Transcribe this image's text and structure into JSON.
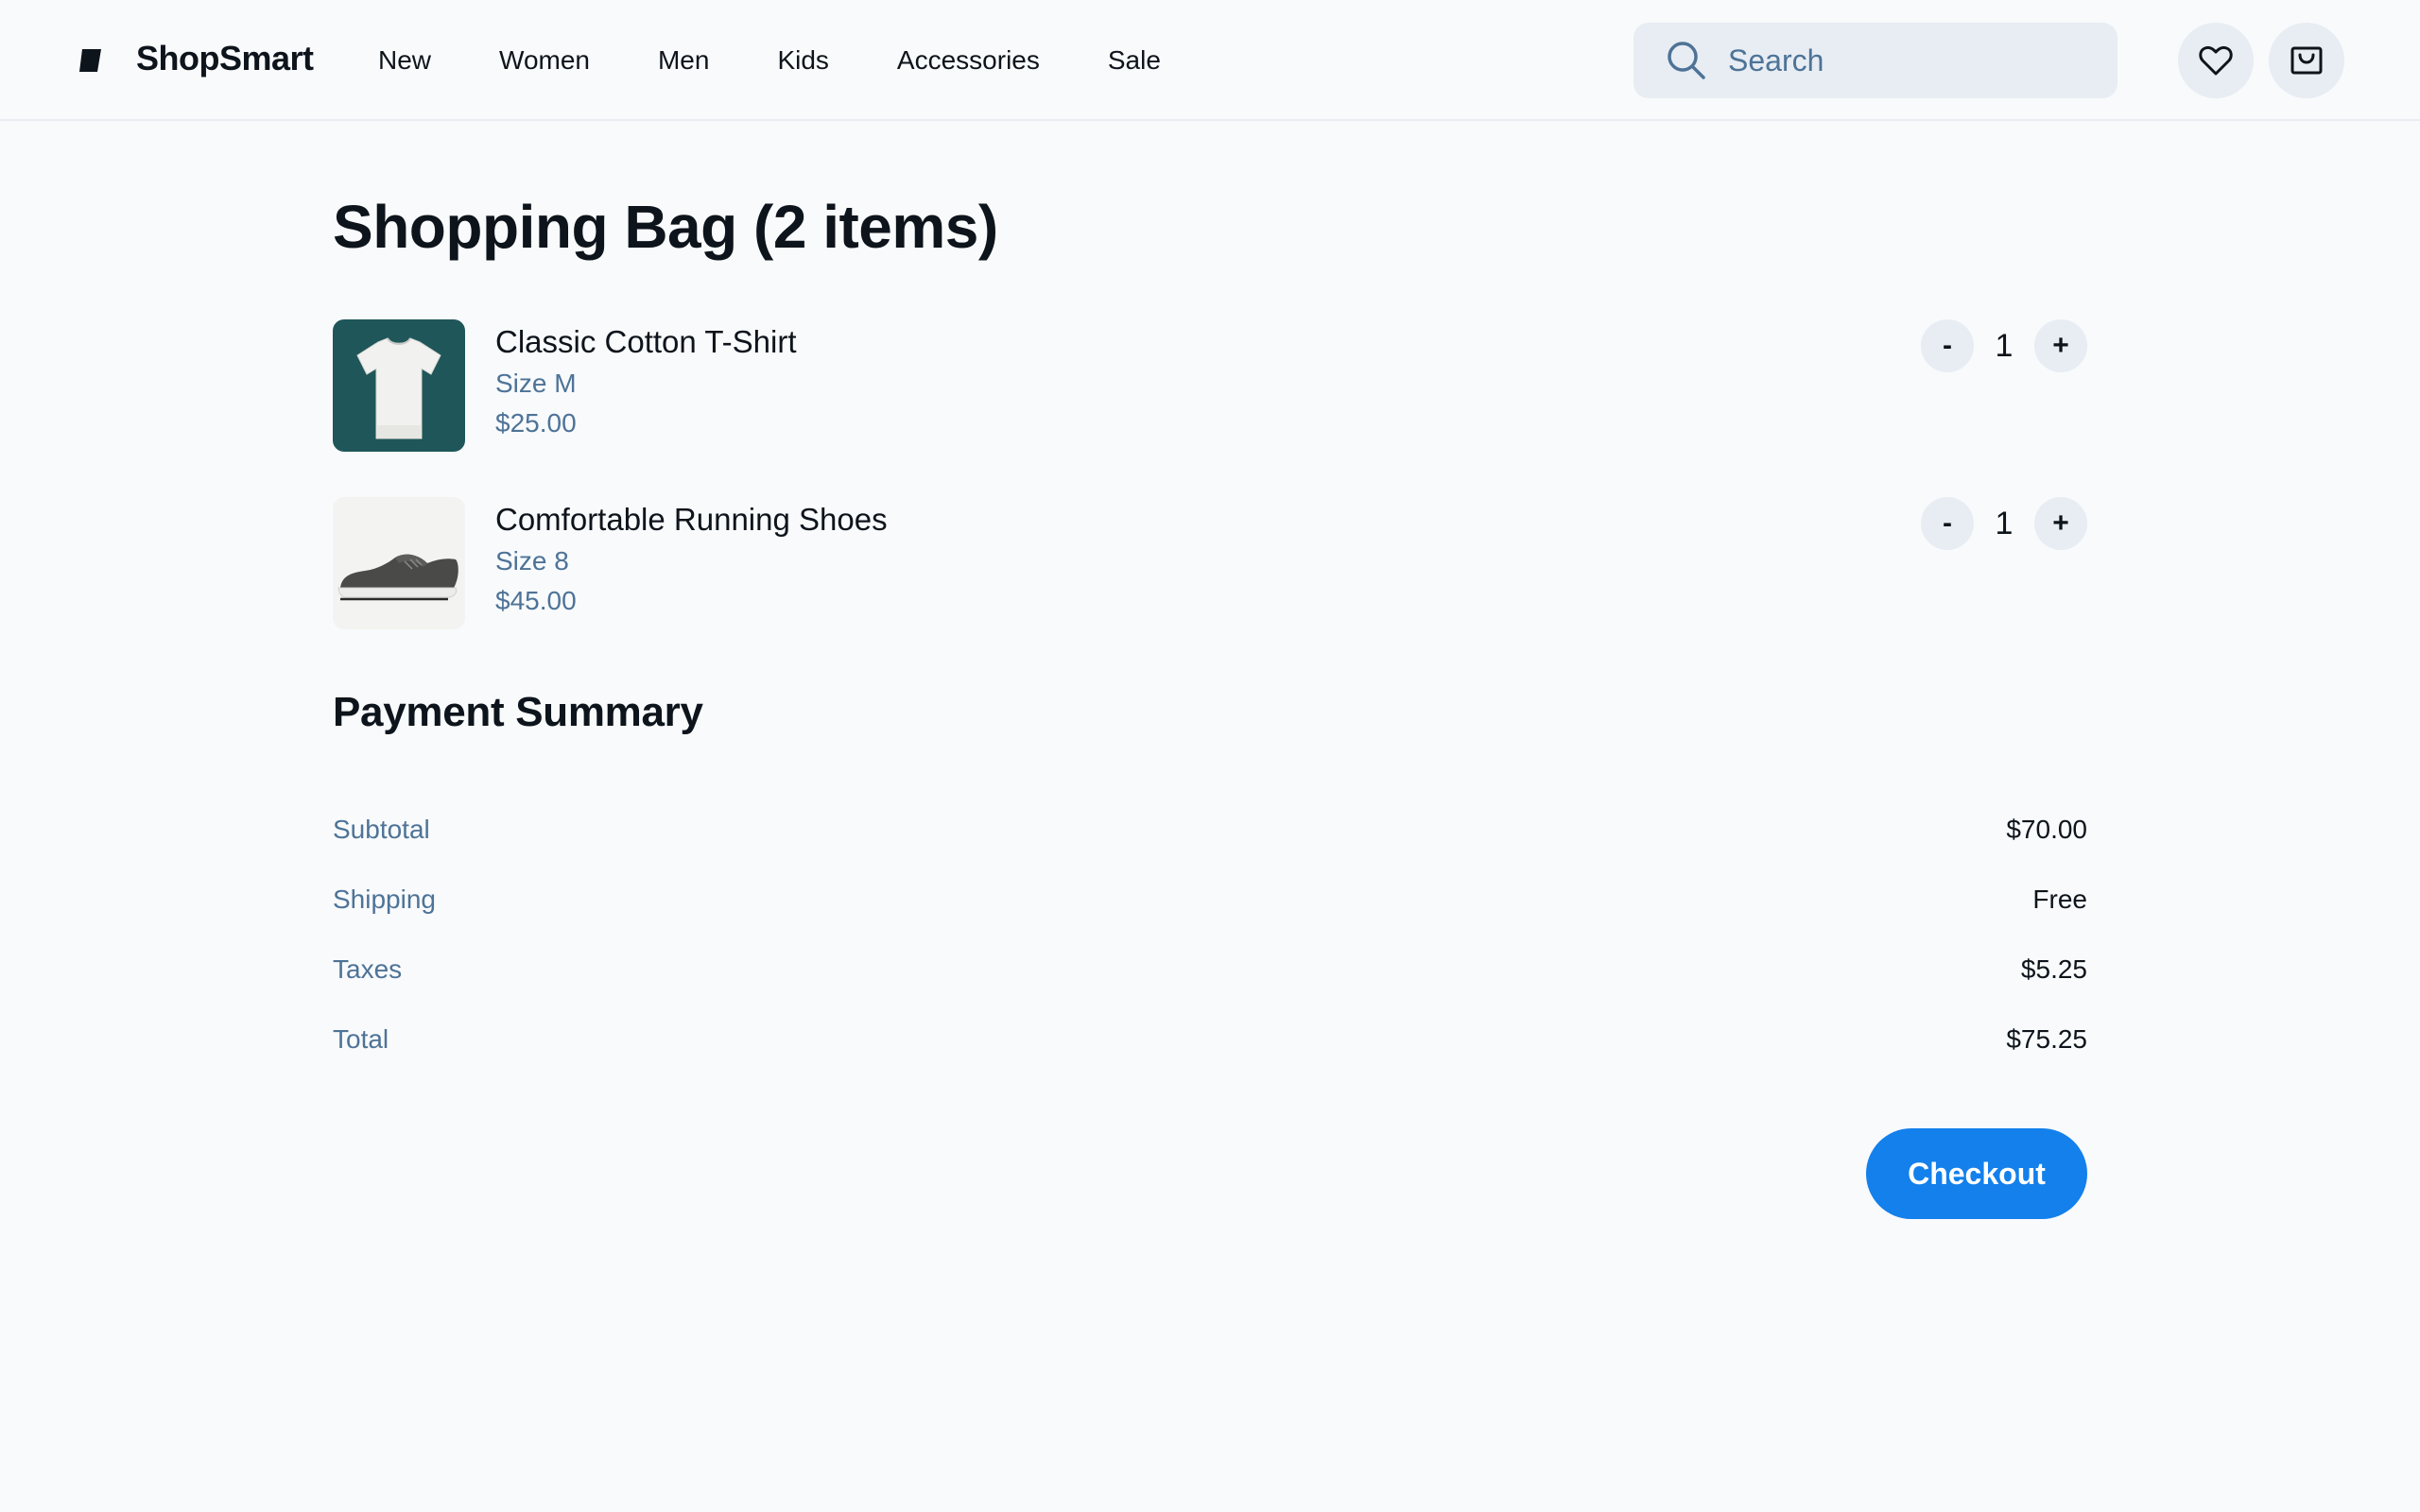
{
  "header": {
    "brand": "ShopSmart",
    "logo_icon": "shop-logo-icon",
    "nav": [
      "New",
      "Women",
      "Men",
      "Kids",
      "Accessories",
      "Sale"
    ],
    "search": {
      "placeholder": "Search",
      "value": "",
      "icon": "search-icon"
    },
    "actions": [
      {
        "icon": "heart-icon",
        "label": "Wishlist"
      },
      {
        "icon": "shopping-bag-icon",
        "label": "Bag"
      }
    ]
  },
  "main": {
    "title": "Shopping Bag (2 items)",
    "items": [
      {
        "name": "Classic Cotton T-Shirt",
        "size": "Size M",
        "price": "$25.00",
        "quantity": "1",
        "decrement": "-",
        "increment": "+",
        "image": "white-tshirt-image"
      },
      {
        "name": "Comfortable Running Shoes",
        "size": "Size 8",
        "price": "$45.00",
        "quantity": "1",
        "decrement": "-",
        "increment": "+",
        "image": "running-shoe-image"
      }
    ],
    "summary": {
      "title": "Payment Summary",
      "rows": [
        {
          "label": "Subtotal",
          "value": "$70.00"
        },
        {
          "label": "Shipping",
          "value": "Free"
        },
        {
          "label": "Taxes",
          "value": "$5.25"
        },
        {
          "label": "Total",
          "value": "$75.25"
        }
      ]
    },
    "checkout_label": "Checkout"
  },
  "colors": {
    "background": "#f8fafc",
    "text_primary": "#0e141b",
    "text_secondary": "#4e7397",
    "control_bg": "#e7edf3",
    "accent": "#1380ec",
    "tshirt_bg": "#1f5659"
  }
}
